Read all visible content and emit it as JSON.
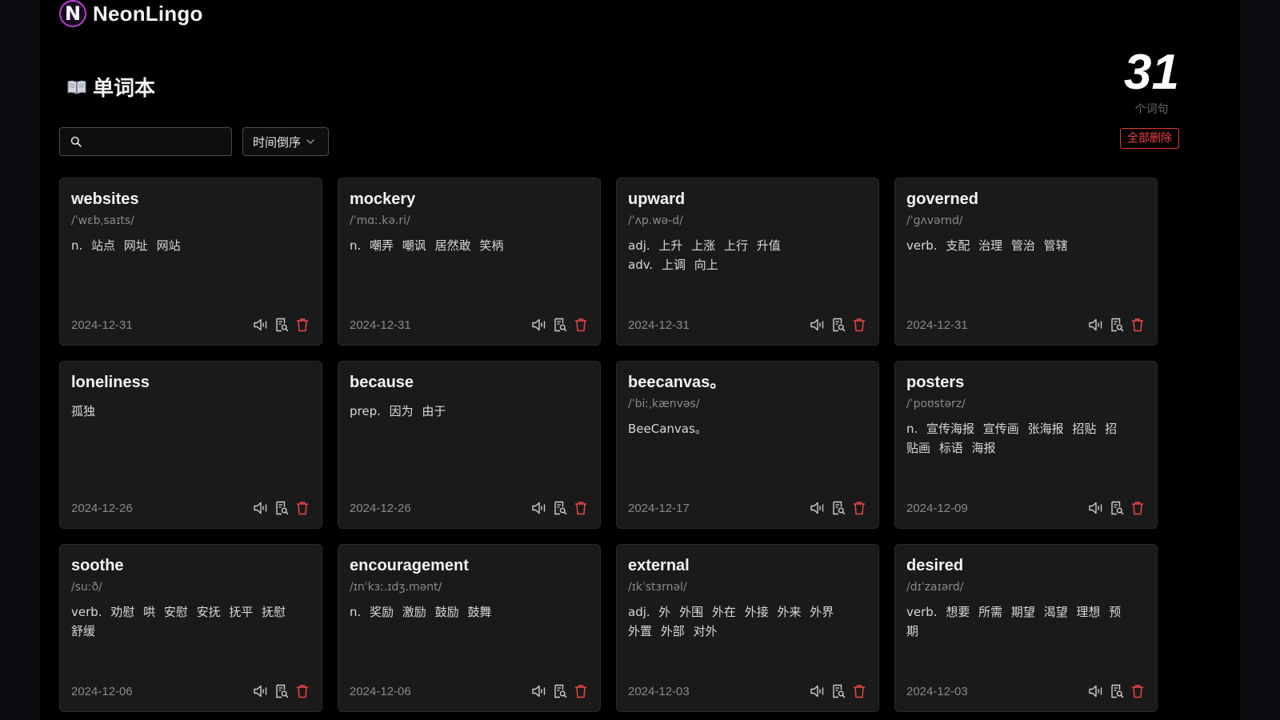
{
  "brand": {
    "logo_letter": "N",
    "name": "NeonLingo",
    "logo_color": "#c03bd8"
  },
  "page": {
    "title": "单词本",
    "title_icon": "book-icon"
  },
  "counter": {
    "count": "31",
    "label": "个词句"
  },
  "toolbar": {
    "search": {
      "placeholder": "",
      "value": "",
      "icon": "search-icon"
    },
    "sort": {
      "selected": "时间倒序",
      "icon": "chevron-down-icon"
    },
    "delete_all_label": "全部删除"
  },
  "colors": {
    "danger": "#ef4444",
    "card_bg": "#1a1a1b",
    "bg": "#000000"
  },
  "card_actions": [
    "speaker-icon",
    "detail-icon",
    "trash-icon"
  ],
  "cards": [
    {
      "word": "websites",
      "phonetic": "/ˈwɛbˌsaɪts/",
      "defs": [
        "n. 站点  网址  网站"
      ],
      "date": "2024-12-31"
    },
    {
      "word": "mockery",
      "phonetic": "/ˈmɑː.kə.ri/",
      "defs": [
        "n. 嘲弄  嘲讽  居然敢  笑柄"
      ],
      "date": "2024-12-31"
    },
    {
      "word": "upward",
      "phonetic": "/ˈʌp.wə-d/",
      "defs": [
        "adj. 上升  上涨  上行  升值",
        "adv. 上调  向上"
      ],
      "date": "2024-12-31"
    },
    {
      "word": "governed",
      "phonetic": "/ˈɡʌvərnd/",
      "defs": [
        "verb. 支配  治理  管治  管辖"
      ],
      "date": "2024-12-31"
    },
    {
      "word": "loneliness",
      "phonetic": "",
      "defs": [
        "孤独"
      ],
      "date": "2024-12-26"
    },
    {
      "word": "because",
      "phonetic": "",
      "defs": [
        "prep. 因为  由于"
      ],
      "date": "2024-12-26"
    },
    {
      "word": "beecanvas。",
      "phonetic": "/ˈbiːˌkænvəs/",
      "defs": [
        "BeeCanvas。"
      ],
      "date": "2024-12-17"
    },
    {
      "word": "posters",
      "phonetic": "/ˈpoʊstərz/",
      "defs": [
        "n. 宣传海报  宣传画  张海报  招贴  招",
        "贴画  标语  海报"
      ],
      "date": "2024-12-09"
    },
    {
      "word": "soothe",
      "phonetic": "/suːð/",
      "defs": [
        "verb. 劝慰  哄  安慰  安抚  抚平  抚慰",
        "舒缓"
      ],
      "date": "2024-12-06"
    },
    {
      "word": "encouragement",
      "phonetic": "/ɪnˈkɜː.ɪdʒ.mənt/",
      "defs": [
        "n. 奖励  激励  鼓励  鼓舞"
      ],
      "date": "2024-12-06"
    },
    {
      "word": "external",
      "phonetic": "/ɪkˈstɜrnəl/",
      "defs": [
        "adj. 外  外围  外在  外接  外来  外界",
        "外置  外部  对外"
      ],
      "date": "2024-12-03"
    },
    {
      "word": "desired",
      "phonetic": "/dɪˈzaɪərd/",
      "defs": [
        "verb. 想要  所需  期望  渴望  理想  预",
        "期"
      ],
      "date": "2024-12-03"
    }
  ]
}
